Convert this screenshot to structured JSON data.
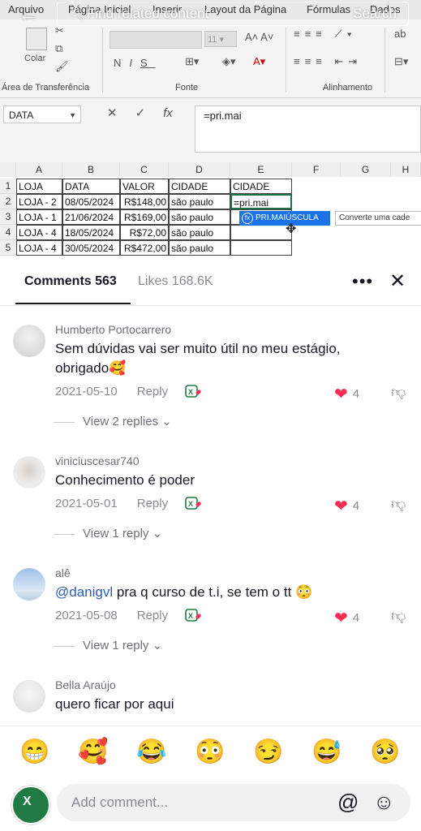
{
  "search": {
    "placeholder": "Find related content",
    "button": "Search"
  },
  "excel": {
    "ribbon_tabs": [
      "Arquivo",
      "Página Inicial",
      "Inserir",
      "Layout da Página",
      "Fórmulas",
      "Dados"
    ],
    "groups": [
      "Área de Transferência",
      "Fonte",
      "Alinhamento"
    ],
    "paste_label": "Colar",
    "name_box": "DATA",
    "formula": "=pri.mai",
    "columns": [
      "A",
      "B",
      "C",
      "D",
      "E",
      "F",
      "G",
      "H"
    ],
    "rows": [
      [
        "LOJA",
        "DATA",
        "VALOR",
        "CIDADE",
        "CIDADE"
      ],
      [
        "LOJA - 2",
        "08/05/2024",
        "R$148,00",
        "são paulo",
        "=pri.mai"
      ],
      [
        "LOJA - 1",
        "21/06/2024",
        "R$169,00",
        "são paulo",
        ""
      ],
      [
        "LOJA - 4",
        "18/05/2024",
        "R$72,00",
        "são paulo",
        ""
      ],
      [
        "LOJA - 4",
        "30/05/2024",
        "R$472,00",
        "são paulo",
        ""
      ]
    ],
    "autocomplete": "PRI.MAIÚSCULA",
    "tooltip": "Converte uma cade"
  },
  "tabs": {
    "comments": "Comments 563",
    "likes": "Likes 168.6K"
  },
  "comments": [
    {
      "user": "Humberto Portocarrero",
      "text_line1": "Sem dúvidas vai ser muito útil no meu estágio,",
      "text_line2": "obrigado🥰",
      "date": "2021-05-10",
      "reply": "Reply",
      "likes": "4",
      "view_replies": "View 2 replies"
    },
    {
      "user": "viniciuscesar740",
      "text_line1": "Conhecimento é poder",
      "date": "2021-05-01",
      "reply": "Reply",
      "likes": "4",
      "view_replies": "View 1 reply"
    },
    {
      "user": "alê",
      "mention": "@danigvl",
      "text_line1": " pra q curso de t.i, se tem o tt 😳",
      "date": "2021-05-08",
      "reply": "Reply",
      "likes": "4",
      "view_replies": "View 1 reply"
    },
    {
      "user": "Bella Araújo",
      "text_line1": "quero ficar por aqui"
    }
  ],
  "emojis": [
    "😁",
    "🥰",
    "😂",
    "😳",
    "😏",
    "😅",
    "🥺"
  ],
  "input": {
    "placeholder": "Add comment..."
  },
  "colors": {
    "like_red": "#fe2c55",
    "excel_green": "#1f7a44",
    "mention_blue": "#2b5db6"
  }
}
